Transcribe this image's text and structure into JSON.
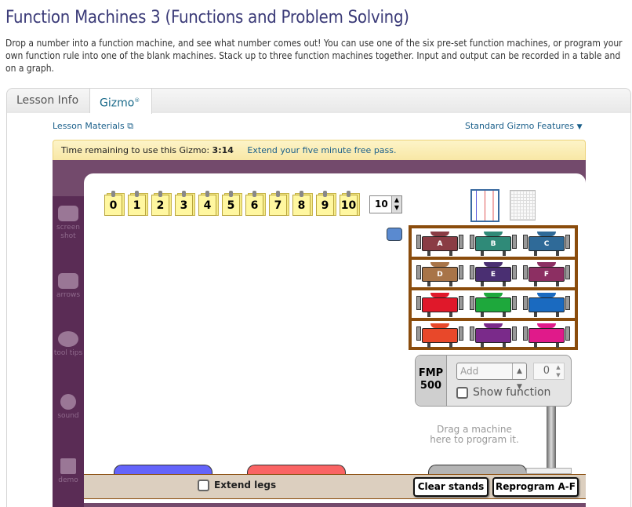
{
  "page": {
    "title": "Function Machines 3 (Functions and Problem Solving)",
    "description": "Drop a number into a function machine, and see what number comes out! You can use one of the six pre-set function machines, or program your own function rule into one of the blank machines. Stack up to three function machines together. Input and output can be recorded in a table and on a graph."
  },
  "tabs": [
    {
      "label": "Lesson Info",
      "active": false
    },
    {
      "label": "Gizmo",
      "sup": "®",
      "active": true
    }
  ],
  "links": {
    "lesson_materials": "Lesson Materials",
    "standard_features": "Standard Gizmo Features"
  },
  "timer": {
    "label": "Time remaining to use this Gizmo:",
    "value": "3:14",
    "extend": "Extend your five minute free pass."
  },
  "sidebar": [
    {
      "label": "screen shot",
      "icon": "camera-icon"
    },
    {
      "label": "arrows",
      "icon": "arrows-icon"
    },
    {
      "label": "tool tips",
      "icon": "speech-bubble-icon"
    },
    {
      "label": "sound",
      "icon": "speaker-icon"
    },
    {
      "label": "demo",
      "icon": "tv-icon"
    }
  ],
  "cards": [
    "0",
    "1",
    "2",
    "3",
    "4",
    "5",
    "6",
    "7",
    "8",
    "9",
    "10"
  ],
  "card_stepper": "10",
  "machines": [
    [
      {
        "label": "A",
        "color": "#8a3c44"
      },
      {
        "label": "B",
        "color": "#2f8a78"
      },
      {
        "label": "C",
        "color": "#2f6a98"
      }
    ],
    [
      {
        "label": "D",
        "color": "#a87448"
      },
      {
        "label": "E",
        "color": "#4a2f72"
      },
      {
        "label": "F",
        "color": "#8c2f62"
      }
    ],
    [
      {
        "label": "",
        "color": "#e0182a"
      },
      {
        "label": "",
        "color": "#1ea83c"
      },
      {
        "label": "",
        "color": "#1a6ac0"
      }
    ],
    [
      {
        "label": "",
        "color": "#e8482a"
      },
      {
        "label": "",
        "color": "#7a2a8a"
      },
      {
        "label": "",
        "color": "#e01a8a"
      }
    ]
  ],
  "fmp": {
    "label1": "FMP",
    "label2": "500",
    "operation": "Add",
    "value": "0",
    "show_function": "Show function",
    "show_function_checked": false
  },
  "drag_hint1": "Drag a machine",
  "drag_hint2": "here to program it.",
  "stands": [
    {
      "color": "#6464fa"
    },
    {
      "color": "#fa6464"
    },
    {
      "color": "#b4b4b4"
    }
  ],
  "bottom": {
    "extend_legs": "Extend legs",
    "extend_checked": false,
    "clear": "Clear stands",
    "reprogram": "Reprogram A-F"
  }
}
